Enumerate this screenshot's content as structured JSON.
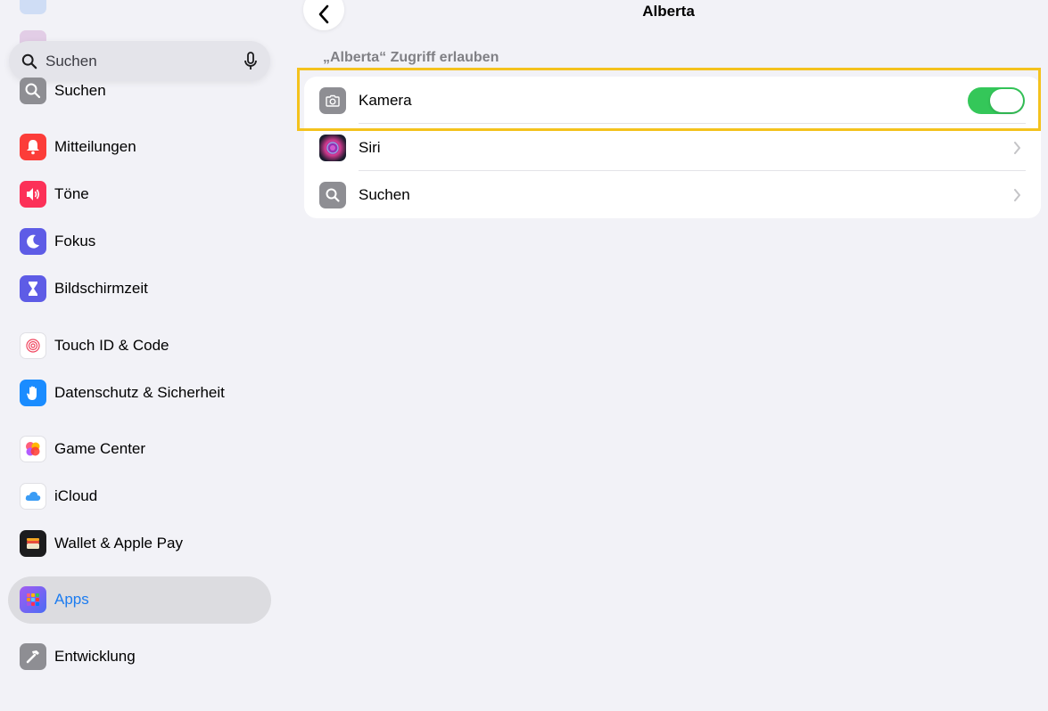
{
  "sidebar": {
    "search": {
      "placeholder": "Suchen"
    },
    "items": [
      {
        "label": "Suchen",
        "icon": "magnifier-icon",
        "color": "#8e8e93"
      },
      {
        "label": "Mitteilungen",
        "icon": "bell-icon",
        "color": "#fc3d39"
      },
      {
        "label": "Töne",
        "icon": "speaker-icon",
        "color": "#fc3158"
      },
      {
        "label": "Fokus",
        "icon": "moon-icon",
        "color": "#5e5ce6"
      },
      {
        "label": "Bildschirmzeit",
        "icon": "hourglass-icon",
        "color": "#5e5ce6"
      },
      {
        "label": "Touch ID & Code",
        "icon": "fingerprint-icon",
        "color": "#ffffff"
      },
      {
        "label": "Datenschutz & Sicherheit",
        "icon": "hand-icon",
        "color": "#1a8cff"
      },
      {
        "label": "Game Center",
        "icon": "game-center-icon",
        "color": "#ffffff"
      },
      {
        "label": "iCloud",
        "icon": "cloud-icon",
        "color": "#ffffff"
      },
      {
        "label": "Wallet & Apple Pay",
        "icon": "wallet-icon",
        "color": "#1c1c1e"
      },
      {
        "label": "Apps",
        "icon": "apps-grid-icon",
        "color": "#6e5cf0",
        "selected": true
      },
      {
        "label": "Entwicklung",
        "icon": "hammer-icon",
        "color": "#8e8e93"
      }
    ]
  },
  "main": {
    "title": "Alberta",
    "section_header": "„Alberta“ Zugriff erlauben",
    "rows": [
      {
        "label": "Kamera",
        "icon": "camera-icon",
        "control": "toggle",
        "toggle_on": true
      },
      {
        "label": "Siri",
        "icon": "siri-icon",
        "control": "chevron"
      },
      {
        "label": "Suchen",
        "icon": "magnifier-icon",
        "control": "chevron"
      }
    ]
  },
  "colors": {
    "accent": "#1c7cf0",
    "toggle_on": "#34c759",
    "highlight": "#f4c21d"
  }
}
